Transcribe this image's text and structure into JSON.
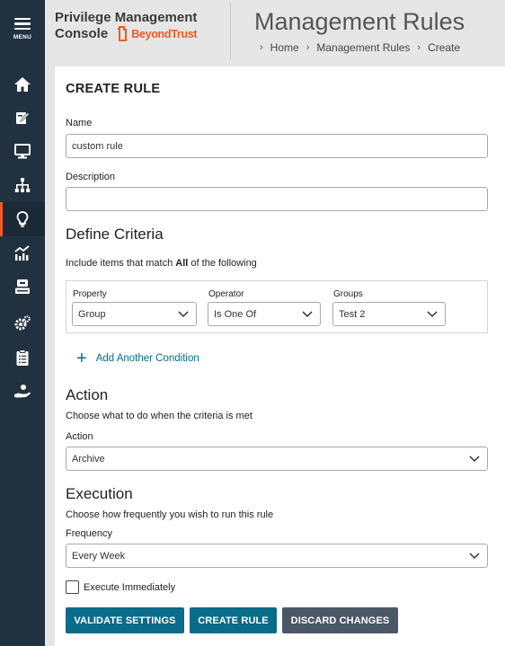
{
  "sidebar": {
    "menu_label": "MENU",
    "items": [
      {
        "icon": "home-icon",
        "active": false
      },
      {
        "icon": "policy-edit-icon",
        "active": false
      },
      {
        "icon": "computer-icon",
        "active": false
      },
      {
        "icon": "hierarchy-icon",
        "active": false
      },
      {
        "icon": "lightbulb-icon",
        "active": true
      },
      {
        "icon": "analytics-icon",
        "active": false
      },
      {
        "icon": "server-icon",
        "active": false
      },
      {
        "icon": "settings-icon",
        "active": false
      },
      {
        "icon": "clipboard-icon",
        "active": false
      },
      {
        "icon": "hand-icon",
        "active": false
      }
    ],
    "active_color": "#f15a22",
    "background": "#22313f"
  },
  "header": {
    "brand_line1": "Privilege Management",
    "brand_line2": "Console",
    "logo_text": "BeyondTrust",
    "page_title": "Management Rules",
    "breadcrumb": [
      "Home",
      "Management Rules",
      "Create"
    ]
  },
  "form": {
    "heading": "CREATE RULE",
    "name_label": "Name",
    "name_value": "custom rule",
    "description_label": "Description",
    "description_value": "",
    "criteria": {
      "title": "Define Criteria",
      "intro_prefix": "Include items that match",
      "intro_bold": "All",
      "intro_suffix": "of the following",
      "property_label": "Property",
      "property_value": "Group",
      "operator_label": "Operator",
      "operator_value": "Is One Of",
      "groups_label": "Groups",
      "groups_value": "Test 2",
      "add_condition": "Add Another Condition"
    },
    "action": {
      "title": "Action",
      "description": "Choose what to do when the criteria is met",
      "label": "Action",
      "value": "Archive"
    },
    "execution": {
      "title": "Execution",
      "description": "Choose how frequently you wish to run this rule",
      "frequency_label": "Frequency",
      "frequency_value": "Every Week",
      "execute_immediately_label": "Execute Immediately",
      "execute_immediately_checked": false
    },
    "buttons": {
      "validate": "VALIDATE SETTINGS",
      "create": "CREATE RULE",
      "discard": "DISCARD CHANGES"
    }
  },
  "colors": {
    "primary_button": "#0a6b8a",
    "secondary_button": "#4a5866",
    "link": "#006e8c",
    "brand_orange": "#f15a22"
  }
}
